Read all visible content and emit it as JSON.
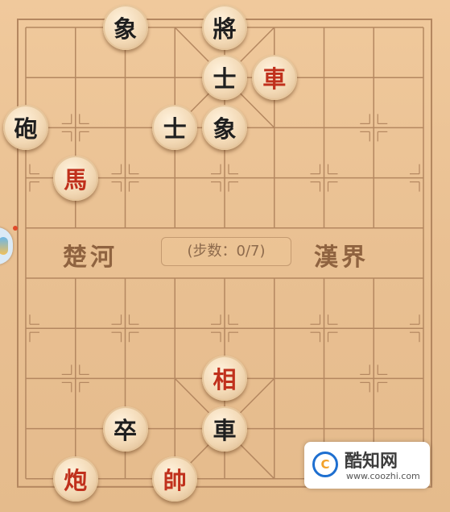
{
  "river": {
    "left": "楚河",
    "right": "漢界"
  },
  "step_counter": "(步数：0/7)",
  "pieces": [
    {
      "char": "象",
      "side": "black",
      "file": 2,
      "rank": 0
    },
    {
      "char": "將",
      "side": "black",
      "file": 4,
      "rank": 0
    },
    {
      "char": "士",
      "side": "black",
      "file": 4,
      "rank": 1
    },
    {
      "char": "車",
      "side": "red",
      "file": 5,
      "rank": 1
    },
    {
      "char": "砲",
      "side": "black",
      "file": 0,
      "rank": 2
    },
    {
      "char": "士",
      "side": "black",
      "file": 3,
      "rank": 2
    },
    {
      "char": "象",
      "side": "black",
      "file": 4,
      "rank": 2
    },
    {
      "char": "馬",
      "side": "red",
      "file": 1,
      "rank": 3
    },
    {
      "char": "相",
      "side": "red",
      "file": 4,
      "rank": 7
    },
    {
      "char": "卒",
      "side": "black",
      "file": 2,
      "rank": 8
    },
    {
      "char": "車",
      "side": "black",
      "file": 4,
      "rank": 8
    },
    {
      "char": "炮",
      "side": "red",
      "file": 1,
      "rank": 9
    },
    {
      "char": "帥",
      "side": "red",
      "file": 3,
      "rank": 9
    }
  ],
  "colors": {
    "red_piece": "#c0301c",
    "black_piece": "#1f1f1f",
    "board": "#e9c092",
    "line": "#b48760"
  },
  "watermark": {
    "logo": "C",
    "title": "酷知网",
    "url": "www.coozhi.com"
  }
}
